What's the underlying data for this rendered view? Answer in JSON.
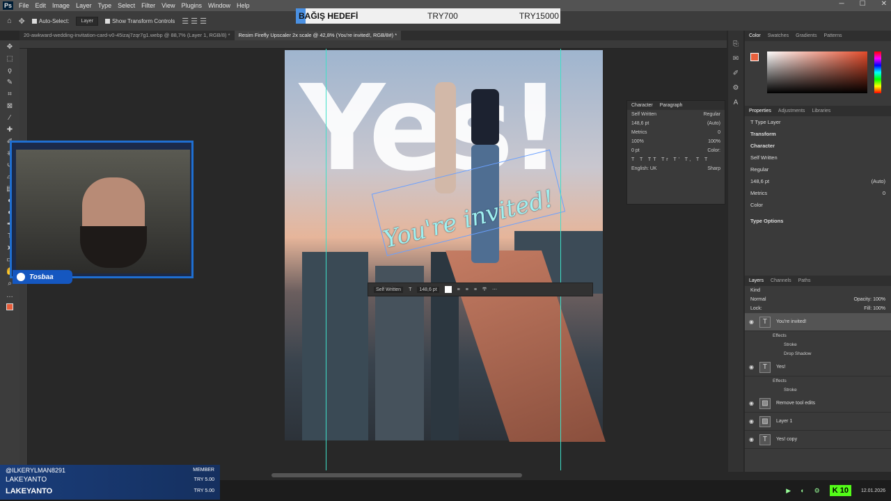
{
  "menu": {
    "items": [
      "File",
      "Edit",
      "Image",
      "Layer",
      "Type",
      "Select",
      "Filter",
      "View",
      "Plugins",
      "Window",
      "Help"
    ]
  },
  "options": {
    "auto_select": "Auto-Select:",
    "layer_select": "Layer",
    "show_transform": "Show Transform Controls"
  },
  "donation": {
    "label": "BAĞIŞ HEDEFİ",
    "current": "TRY700",
    "goal": "TRY15000",
    "progress": 0.047
  },
  "tabs": [
    {
      "label": "20-awkward-wedding-invitation-card-v0-45izaj7zqr7g1.webp @ 88,7% (Layer 1, RGB/8) *"
    },
    {
      "label": "Resim Firefly Upscaler 2x scale @ 42,8% (You're invited!, RGB/8#) *"
    }
  ],
  "canvas": {
    "headline": "Yes!",
    "invite_text": "You're invited!"
  },
  "context_bar": {
    "font": "Self Written",
    "size": "148,6 pt"
  },
  "character": {
    "tabs": [
      "Character",
      "Paragraph"
    ],
    "font": "Self Written",
    "style": "Regular",
    "size": "148,6 pt",
    "leading": "(Auto)",
    "kerning": "Metrics",
    "tracking": "0",
    "vscale": "100%",
    "hscale": "100%",
    "baseline": "0 pt",
    "color_label": "Color:",
    "language": "English: UK",
    "aa": "Sharp"
  },
  "webcam": {
    "brand": "Tosbaa"
  },
  "color_panel": {
    "tabs": [
      "Color",
      "Swatches",
      "Gradients",
      "Patterns"
    ]
  },
  "properties": {
    "tabs": [
      "Properties",
      "Adjustments",
      "Libraries"
    ],
    "type_layer": "Type Layer",
    "transform": "Transform",
    "character": "Character",
    "font": "Self Written",
    "style": "Regular",
    "size": "148,6 pt",
    "leading": "(Auto)",
    "kerning": "Metrics",
    "tracking": "0",
    "color_label": "Color",
    "type_options": "Type Options"
  },
  "layers_panel": {
    "tabs": [
      "Layers",
      "Channels",
      "Paths"
    ],
    "kind": "Kind",
    "blend": "Normal",
    "opacity_label": "Opacity:",
    "opacity": "100%",
    "lock_label": "Lock:",
    "fill_label": "Fill:",
    "fill": "100%",
    "layers": [
      {
        "name": "You're invited!",
        "type": "T"
      },
      {
        "name": "Yes!",
        "type": "T"
      },
      {
        "name": "Remove tool edits",
        "type": "img"
      },
      {
        "name": "Layer 1",
        "type": "img"
      },
      {
        "name": "Yes! copy",
        "type": "T"
      }
    ],
    "effects_label": "Effects",
    "stroke": "Stroke",
    "drop_shadow": "Drop Shadow"
  },
  "chat": {
    "user1": "@ILKERYLMAN8291",
    "badge": "MEMBER",
    "user2": "LAKEYANTO",
    "amount1": "TRY 5.00",
    "user3": "LAKEYANTO",
    "amount2": "TRY 5.00"
  },
  "taskbar": {
    "date": "12.01.2026",
    "kick_count": "10"
  }
}
